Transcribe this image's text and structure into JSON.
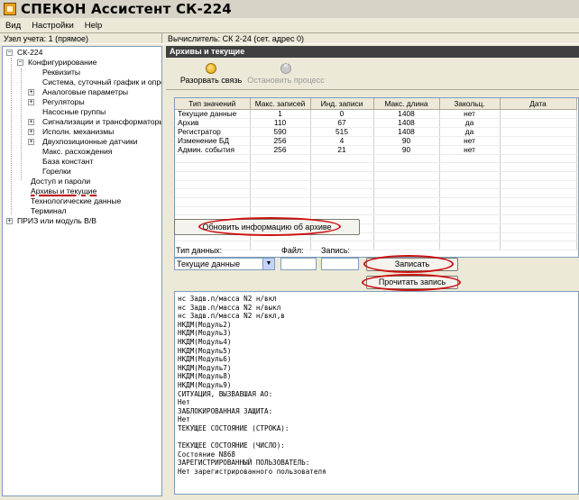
{
  "window": {
    "title": "СПЕКОН Ассистент СК-224"
  },
  "menu": [
    "Вид",
    "Настройки",
    "Help"
  ],
  "status": {
    "node": "Узел учета: 1 (прямое)",
    "calculator": "Вычислитель: СК 2-24 (сет. адрес 0)"
  },
  "tree": [
    {
      "label": "СК-224",
      "expander": "−"
    },
    {
      "label": "Конфигурирование",
      "expander": "−"
    },
    {
      "label": "Реквизиты"
    },
    {
      "label": "Система, суточный график и опрессо"
    },
    {
      "label": "Аналоговые параметры",
      "expander": "+"
    },
    {
      "label": "Регуляторы",
      "expander": "+"
    },
    {
      "label": "Насосные группы"
    },
    {
      "label": "Сигнализации и трансформаторы",
      "expander": "+"
    },
    {
      "label": "Исполн. механизмы",
      "expander": "+"
    },
    {
      "label": "Двухпозиционные датчики",
      "expander": "+"
    },
    {
      "label": "Макс. расхождения"
    },
    {
      "label": "База констант"
    },
    {
      "label": "Горелки"
    },
    {
      "label": "Доступ и пароли"
    },
    {
      "label": "Архивы и текущие",
      "selected": true
    },
    {
      "label": "Технологические данные"
    },
    {
      "label": "Терминал"
    },
    {
      "label": "ПРИЗ или модуль В/В",
      "expander": "+"
    }
  ],
  "panel": {
    "header": "Архивы и текущие",
    "toolbar": {
      "disconnect": "Разорвать связь",
      "stop": "Остановить процесс"
    },
    "grid": {
      "columns": [
        "Тип значений",
        "Макс. записей",
        "Инд. записи",
        "Макс. длина",
        "Закольц.",
        "Дата"
      ],
      "rows": [
        [
          "Текущие данные",
          "1",
          "0",
          "1408",
          "нет",
          ""
        ],
        [
          "Архив",
          "110",
          "67",
          "1408",
          "да",
          ""
        ],
        [
          "Регистратор",
          "590",
          "515",
          "1408",
          "да",
          ""
        ],
        [
          "Изменение БД",
          "256",
          "4",
          "90",
          "нет",
          ""
        ],
        [
          "Админ. события",
          "256",
          "21",
          "90",
          "нет",
          ""
        ]
      ]
    },
    "update_button": "Обновить информацию об архиве",
    "form": {
      "type_label": "Тип данных:",
      "type_value": "Текущие данные",
      "file_label": "Файл:",
      "record_label": "Запись:",
      "write_button": "Записать",
      "read_button": "Прочитать запись"
    },
    "console_lines": [
      "нс Задв.п/масса N2 н/вкл",
      "нс Задв.п/масса N2 н/выкл",
      "нс Задв.п/масса N2 н/вкл,в",
      "НКДМ(Модуль2)",
      "НКДМ(Модуль3)",
      "НКДМ(Модуль4)",
      "НКДМ(Модуль5)",
      "НКДМ(Модуль6)",
      "НКДМ(Модуль7)",
      "НКДМ(Модуль8)",
      "НКДМ(Модуль9)",
      "СИТУАЦИЯ, ВЫЗВАВШАЯ АО:",
      "Нет",
      "ЗАБЛОКИРОВАННАЯ ЗАЩИТА:",
      "Нет",
      "ТЕКУЩЕЕ СОСТОЯНИЕ (СТРОКА):",
      "",
      "ТЕКУЩЕЕ СОСТОЯНИЕ (ЧИСЛО):",
      "Состояние N868",
      "ЗАРЕГИСТРИРОВАННЫЙ ПОЛЬЗОВАТЕЛЬ:",
      "Нет зарегистрированного пользователя"
    ]
  },
  "colors": {
    "annotation": "#cc1010",
    "header_bg": "#404040"
  }
}
